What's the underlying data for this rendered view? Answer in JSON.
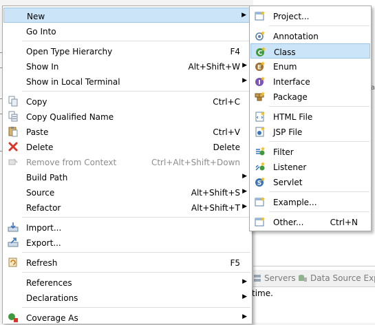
{
  "background": {
    "tabs": [
      {
        "label": "Servers",
        "icon": "servers-icon"
      },
      {
        "label": "Data Source Exp",
        "icon": "data-source-explorer-icon"
      }
    ],
    "status_text": "time.",
    "right_marker": "a"
  },
  "main_menu": {
    "items": [
      {
        "label": "New",
        "shortcut": "",
        "submenu": true,
        "highlighted": true,
        "icon": ""
      },
      {
        "label": "Go Into",
        "shortcut": "",
        "submenu": false,
        "icon": ""
      },
      {
        "label": "Open Type Hierarchy",
        "shortcut": "F4",
        "submenu": false,
        "icon": ""
      },
      {
        "label": "Show In",
        "shortcut": "Alt+Shift+W",
        "submenu": true,
        "icon": ""
      },
      {
        "label": "Show in Local Terminal",
        "shortcut": "",
        "submenu": true,
        "icon": ""
      },
      {
        "label": "Copy",
        "shortcut": "Ctrl+C",
        "submenu": false,
        "icon": "copy-icon"
      },
      {
        "label": "Copy Qualified Name",
        "shortcut": "",
        "submenu": false,
        "icon": "copy-qualified-name-icon"
      },
      {
        "label": "Paste",
        "shortcut": "Ctrl+V",
        "submenu": false,
        "icon": "paste-icon"
      },
      {
        "label": "Delete",
        "shortcut": "Delete",
        "submenu": false,
        "icon": "delete-icon"
      },
      {
        "label": "Remove from Context",
        "shortcut": "Ctrl+Alt+Shift+Down",
        "submenu": false,
        "disabled": true,
        "icon": "remove-from-context-icon"
      },
      {
        "label": "Build Path",
        "shortcut": "",
        "submenu": true,
        "icon": ""
      },
      {
        "label": "Source",
        "shortcut": "Alt+Shift+S",
        "submenu": true,
        "icon": ""
      },
      {
        "label": "Refactor",
        "shortcut": "Alt+Shift+T",
        "submenu": true,
        "icon": ""
      },
      {
        "label": "Import...",
        "shortcut": "",
        "submenu": false,
        "icon": "import-icon"
      },
      {
        "label": "Export...",
        "shortcut": "",
        "submenu": false,
        "icon": "export-icon"
      },
      {
        "label": "Refresh",
        "shortcut": "F5",
        "submenu": false,
        "icon": "refresh-icon"
      },
      {
        "label": "References",
        "shortcut": "",
        "submenu": true,
        "icon": ""
      },
      {
        "label": "Declarations",
        "shortcut": "",
        "submenu": true,
        "icon": ""
      },
      {
        "label": "Coverage As",
        "shortcut": "",
        "submenu": true,
        "icon": "coverage-icon"
      }
    ]
  },
  "sub_menu": {
    "items": [
      {
        "label": "Project...",
        "shortcut": "",
        "icon": "new-project-icon"
      },
      {
        "label": "Annotation",
        "shortcut": "",
        "icon": "annotation-icon"
      },
      {
        "label": "Class",
        "shortcut": "",
        "icon": "class-icon",
        "highlighted": true
      },
      {
        "label": "Enum",
        "shortcut": "",
        "icon": "enum-icon"
      },
      {
        "label": "Interface",
        "shortcut": "",
        "icon": "interface-icon"
      },
      {
        "label": "Package",
        "shortcut": "",
        "icon": "package-icon"
      },
      {
        "label": "HTML File",
        "shortcut": "",
        "icon": "html-file-icon"
      },
      {
        "label": "JSP File",
        "shortcut": "",
        "icon": "jsp-file-icon"
      },
      {
        "label": "Filter",
        "shortcut": "",
        "icon": "filter-icon"
      },
      {
        "label": "Listener",
        "shortcut": "",
        "icon": "listener-icon"
      },
      {
        "label": "Servlet",
        "shortcut": "",
        "icon": "servlet-icon"
      },
      {
        "label": "Example...",
        "shortcut": "",
        "icon": "example-icon"
      },
      {
        "label": "Other...",
        "shortcut": "Ctrl+N",
        "icon": "other-wizard-icon"
      }
    ]
  },
  "colors": {
    "highlight": "#cce4f7",
    "disabled_text": "#8d8d8d",
    "delete_red": "#d9352b",
    "class_green": "#3f9a3f",
    "enum_brown": "#a0702a",
    "interface_purple": "#7b55b4",
    "servlet_blue": "#3a73b8"
  }
}
